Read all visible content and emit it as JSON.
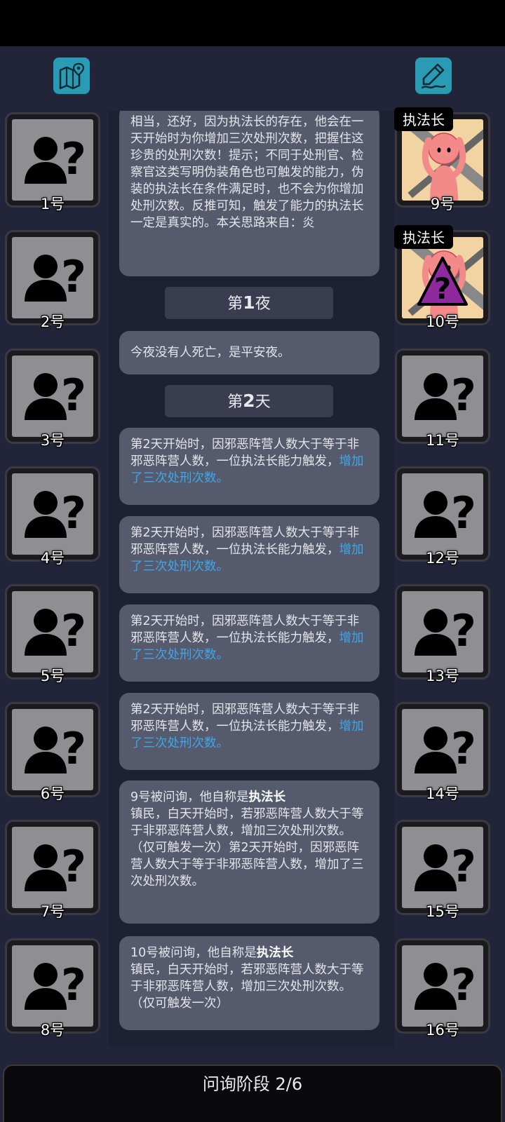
{
  "buttons": {
    "map_icon": "map-pin-icon",
    "notes_icon": "pencil-note-icon"
  },
  "players_left": [
    {
      "number": "1号"
    },
    {
      "number": "2号"
    },
    {
      "number": "3号"
    },
    {
      "number": "4号"
    },
    {
      "number": "5号"
    },
    {
      "number": "6号"
    },
    {
      "number": "7号"
    },
    {
      "number": "8号"
    }
  ],
  "players_right": [
    {
      "number": "9号",
      "role": "执法长"
    },
    {
      "number": "10号",
      "role": "执法长"
    },
    {
      "number": "11号"
    },
    {
      "number": "12号"
    },
    {
      "number": "13号"
    },
    {
      "number": "14号"
    },
    {
      "number": "15号"
    },
    {
      "number": "16号"
    }
  ],
  "log": {
    "intro": "相当，还好，因为执法长的存在，他会在一天开始时为你增加三次处刑次数，把握住这珍贵的处刑次数！提示；不同于处刑官、检察官这类写明伪装角色也可触发的能力，伪装的执法长在条件满足时，也不会为你增加处刑次数。反推可知，触发了能力的执法长一定是真实的。本关思路来自：炎",
    "night1": {
      "prefix": "第",
      "num": "1",
      "suffix": "夜"
    },
    "night1_msg": "今夜没有人死亡，是平安夜。",
    "day2": {
      "prefix": "第",
      "num": "2",
      "suffix": "天"
    },
    "trigger_text": "第2天开始时，因邪恶阵营人数大于等于非邪恶阵营人数，一位执法长能力触发，",
    "trigger_highlight": "增加了三次处刑次数。",
    "q9_head": "9号被问询，他自称是",
    "q9_role": "执法长",
    "q9_body": "镇民，白天开始时，若邪恶阵营人数大于等于非邪恶阵营人数，增加三次处刑次数。（仅可触发一次）第2天开始时，因邪恶阵营人数大于等于非邪恶阵营人数，增加了三次处刑次数。",
    "q10_head": "10号被问询，他自称是",
    "q10_role": "执法长",
    "q10_body": "镇民，白天开始时，若邪恶阵营人数大于等于非邪恶阵营人数，增加三次处刑次数。（仅可触发一次）"
  },
  "status": "问询阶段 2/6",
  "colors": {
    "accent": "#2a9bb4",
    "highlight": "#3ea7ea",
    "background": "#22253a"
  }
}
